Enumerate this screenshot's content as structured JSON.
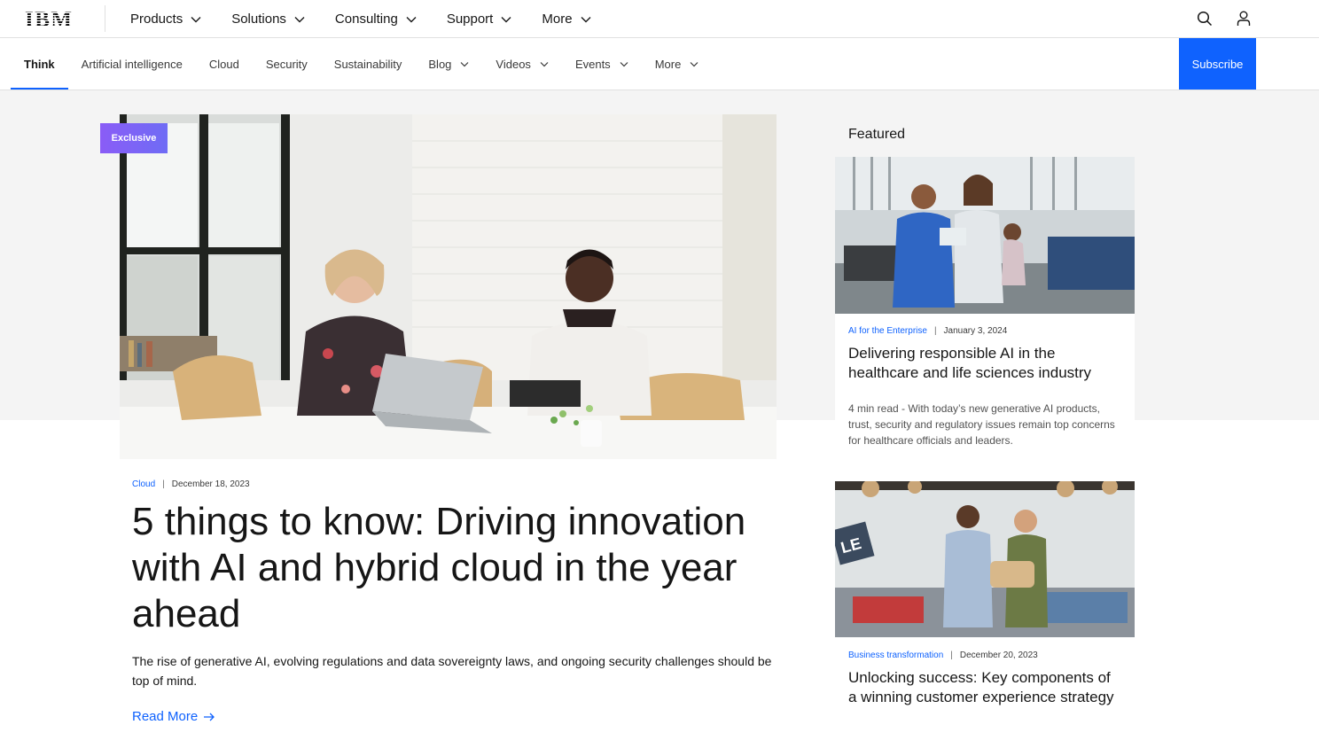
{
  "masthead": {
    "logo_text": "IBM",
    "nav": [
      {
        "label": "Products"
      },
      {
        "label": "Solutions"
      },
      {
        "label": "Consulting"
      },
      {
        "label": "Support"
      },
      {
        "label": "More"
      }
    ],
    "icons": [
      "search-icon",
      "user-icon"
    ]
  },
  "subnav": {
    "items": [
      {
        "label": "Think",
        "active": true,
        "dropdown": false
      },
      {
        "label": "Artificial intelligence",
        "dropdown": false
      },
      {
        "label": "Cloud",
        "dropdown": false
      },
      {
        "label": "Security",
        "dropdown": false
      },
      {
        "label": "Sustainability",
        "dropdown": false
      },
      {
        "label": "Blog",
        "dropdown": true
      },
      {
        "label": "Videos",
        "dropdown": true
      },
      {
        "label": "Events",
        "dropdown": true
      },
      {
        "label": "More",
        "dropdown": true
      }
    ],
    "subscribe_label": "Subscribe"
  },
  "hero": {
    "badge": "Exclusive",
    "category": "Cloud",
    "date": "December 18, 2023",
    "title": "5 things to know: Driving innovation with AI and hybrid cloud in the year ahead",
    "description": "The rise of generative AI, evolving regulations and data sovereignty laws, and ongoing security challenges should be top of mind.",
    "read_more": "Read More"
  },
  "featured": {
    "heading": "Featured",
    "cards": [
      {
        "category": "AI for the Enterprise",
        "date": "January 3, 2024",
        "title": "Delivering responsible AI in the healthcare and life sciences industry",
        "description": "4 min read - With today’s new generative AI products, trust, security and regulatory issues remain top concerns for healthcare officials and leaders."
      },
      {
        "category": "Business transformation",
        "date": "December 20, 2023",
        "title": "Unlocking success: Key components of a winning customer experience strategy"
      }
    ]
  },
  "colors": {
    "accent": "#0f62fe",
    "badge": "#8a5cf6",
    "band": "#f4f4f4"
  }
}
